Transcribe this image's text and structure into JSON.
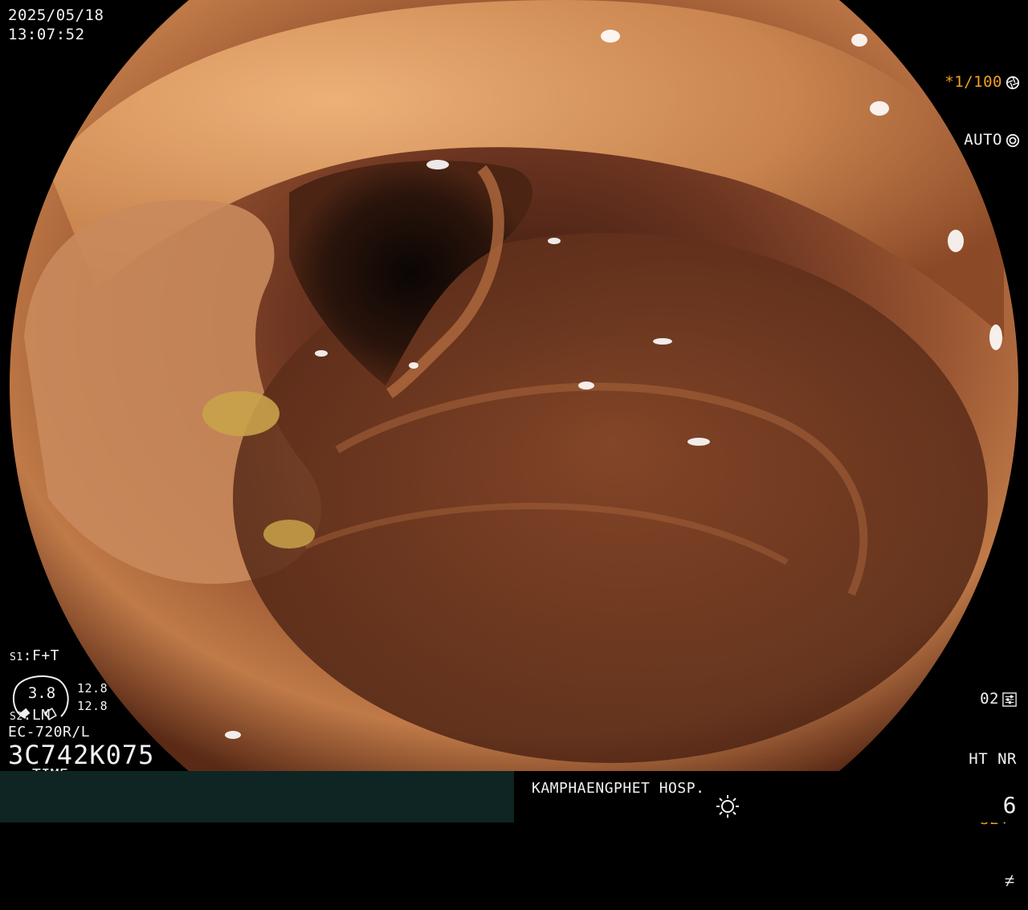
{
  "overlay": {
    "date": "2025/05/18",
    "time": "13:07:52",
    "shutter": "*1/100",
    "exposure_mode": "AUTO",
    "settings": [
      {
        "key": "S1",
        "value": "F+T"
      },
      {
        "key": "S2",
        "value": "LM"
      },
      {
        "key": "S3",
        "value": "TIME"
      }
    ],
    "meter_value": "3.8",
    "meter_right_top": "12.8",
    "meter_right_bottom": "12.8",
    "scope_model": "EC-720R/L",
    "serial": "3C742K075",
    "mode_code": "02",
    "mode_ht_nr": "HT NR",
    "mode_se": "SE",
    "hospital": "KAMPHAENGPHET HOSP.",
    "page_number": "6"
  },
  "icons": [
    "aperture-icon",
    "auto-exposure-icon",
    "setting-slider-icon",
    "se-curve-icon",
    "not-equal-icon",
    "sun-brightness-icon"
  ],
  "colors": {
    "accent_orange": "#f0a020",
    "bottom_bar": "#0e2524",
    "text": "#f2f2f2"
  }
}
